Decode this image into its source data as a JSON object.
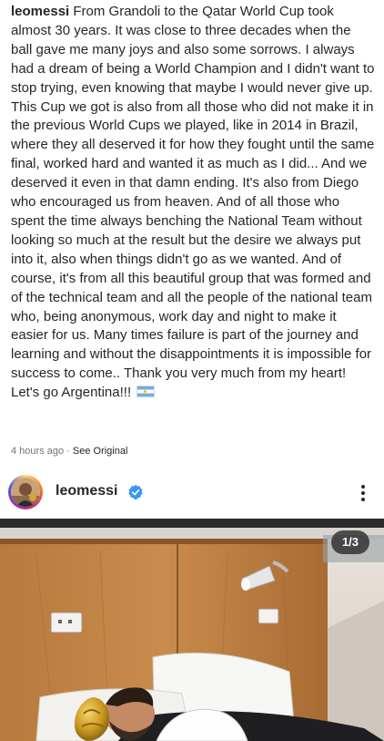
{
  "caption": {
    "username": "leomessi",
    "text": " From Grandoli to the Qatar World Cup took almost 30 years. It was close to three decades when the ball gave me many joys and also some sorrows. I always had a dream of being a World Champion and I didn't want to stop trying, even knowing that maybe I would never give up. This Cup we got is also from all those who did not make it in the previous World Cups we played, like in 2014 in Brazil, where they all deserved it for how they fought until the same final, worked hard and wanted it as much as I did... And we deserved it even in that damn ending. It's also from Diego who encouraged us from heaven. And of all those who spent the time always benching the National Team without looking so much at the result but the desire we always put into it, also when things didn't go as we wanted. And of course, it's from all this beautiful group that was formed and of the technical team and all the people of the national team who, being anonymous, work day and night to make it easier for us. Many times failure is part of the journey and learning and without the disappointments it is impossible for success to come.. Thank you very much from my heart! Let's go Argentina!!! ",
    "flag_icon": "argentina-flag-icon"
  },
  "meta": {
    "time": "4 hours ago",
    "separator": " · ",
    "see_original": "See Original"
  },
  "post": {
    "username": "leomessi",
    "verified_icon": "verified-badge-icon",
    "more_icon": "more-vertical-icon",
    "image_counter": "1/3",
    "accent": "#3897f0"
  }
}
